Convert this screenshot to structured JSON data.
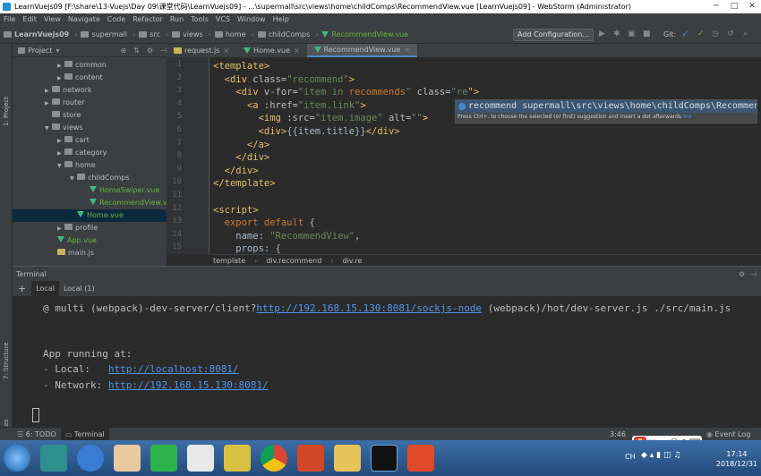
{
  "window": {
    "title": "LearnVuejs09 [F:\\share\\13-Vuejs\\Day 09\\课堂代码\\LearnVuejs09] - ...\\supermall\\src\\views\\home\\childComps\\RecommendView.vue [LearnVuejs09] - WebStorm (Administrator)",
    "min": "─",
    "max": "□",
    "close": "✕"
  },
  "menu": [
    "File",
    "Edit",
    "View",
    "Navigate",
    "Code",
    "Refactor",
    "Run",
    "Tools",
    "VCS",
    "Window",
    "Help"
  ],
  "nav": {
    "crumbs": [
      "LearnVuejs09",
      "supermall",
      "src",
      "views",
      "home",
      "childComps",
      "RecommendView.vue"
    ],
    "add_config": "Add Configuration...",
    "git": "Git:"
  },
  "left_strip": {
    "project": "1: Project",
    "structure": "7: Structure",
    "favorites": "2: Favorites"
  },
  "project": {
    "label": "Project",
    "tree": [
      {
        "name": "common",
        "indent": 1,
        "type": "folder"
      },
      {
        "name": "content",
        "indent": 1,
        "type": "folder"
      },
      {
        "name": "network",
        "indent": 0,
        "type": "folder"
      },
      {
        "name": "router",
        "indent": 0,
        "type": "folder"
      },
      {
        "name": "store",
        "indent": 0,
        "type": "folder"
      },
      {
        "name": "views",
        "indent": 0,
        "type": "folder"
      },
      {
        "name": "cart",
        "indent": 1,
        "type": "folder"
      },
      {
        "name": "category",
        "indent": 1,
        "type": "folder"
      },
      {
        "name": "home",
        "indent": 1,
        "type": "folder"
      },
      {
        "name": "childComps",
        "indent": 2,
        "type": "folder"
      },
      {
        "name": "HomeSwiper.vue",
        "indent": 3,
        "type": "vue"
      },
      {
        "name": "RecommendView.vue",
        "indent": 3,
        "type": "vue"
      },
      {
        "name": "Home.vue",
        "indent": 2,
        "type": "vue"
      },
      {
        "name": "profile",
        "indent": 1,
        "type": "folder"
      },
      {
        "name": "App.vue",
        "indent": 0,
        "type": "vue"
      },
      {
        "name": "main.js",
        "indent": 0,
        "type": "js"
      }
    ]
  },
  "tabs": [
    "request.js",
    "Home.vue",
    "RecommendView.vue"
  ],
  "editor": {
    "line_numbers": [
      "1",
      "2",
      "3",
      "4",
      "5",
      "6",
      "7",
      "8",
      "9",
      "10",
      "11",
      "12",
      "13",
      "14",
      "15"
    ],
    "lines": [
      [
        [
          "tag",
          "<template>"
        ]
      ],
      [
        [
          "tag",
          "  <div "
        ],
        [
          "attr",
          "class="
        ],
        [
          "str",
          "\"recommend\""
        ],
        [
          "tag",
          ">"
        ]
      ],
      [
        [
          "tag",
          "    <div "
        ],
        [
          "attr",
          "v-for="
        ],
        [
          "str",
          "\"item in "
        ],
        [
          "kw",
          "recommends"
        ],
        [
          "str",
          "\" "
        ],
        [
          "attr",
          "class="
        ],
        [
          "str",
          "\"re"
        ],
        [
          "tag",
          "\">"
        ]
      ],
      [
        [
          "tag",
          "      <a "
        ],
        [
          "attr",
          ":href="
        ],
        [
          "str",
          "\"item.link\""
        ],
        [
          "tag",
          ">"
        ]
      ],
      [
        [
          "tag",
          "        <img "
        ],
        [
          "attr",
          ":src="
        ],
        [
          "str",
          "\"item.image\" "
        ],
        [
          "attr",
          "alt="
        ],
        [
          "str",
          "\"\""
        ],
        [
          "tag",
          ">"
        ]
      ],
      [
        [
          "tag",
          "        <div>"
        ],
        [
          "plain",
          "{{item.title}}"
        ],
        [
          "tag",
          "</div>"
        ]
      ],
      [
        [
          "tag",
          "      </a>"
        ]
      ],
      [
        [
          "tag",
          "    </div>"
        ]
      ],
      [
        [
          "tag",
          "  </div>"
        ]
      ],
      [
        [
          "tag",
          "</template>"
        ]
      ],
      [
        [
          "plain",
          ""
        ]
      ],
      [
        [
          "tag",
          "<script>"
        ]
      ],
      [
        [
          "kw",
          "  export default "
        ],
        [
          "plain",
          "{"
        ]
      ],
      [
        [
          "plain",
          "    name: "
        ],
        [
          "str",
          "\"RecommendView\""
        ],
        [
          "plain",
          ","
        ]
      ],
      [
        [
          "plain",
          "    props: {"
        ]
      ]
    ],
    "breadcrumbs": [
      "template",
      "div.recommend",
      "div.re"
    ]
  },
  "popup": {
    "suggestion": "recommend  supermall\\src\\views\\home\\childComps\\RecommendView.vue",
    "hint": "Press Ctrl+. to choose the selected (or first) suggestion and insert a dot afterwards",
    "more": ">>"
  },
  "terminal": {
    "header": "Terminal",
    "tabs": [
      "Local",
      "Local (1)"
    ],
    "line1_pre": "@ multi (webpack)-dev-server/client?",
    "line1_link": "http://192.168.15.130:8081/sockjs-node",
    "line1_post": " (webpack)/hot/dev-server.js ./src/main.js",
    "running": "App running at:",
    "local_label": "- Local:   ",
    "local_url": "http://localhost:8081/",
    "network_label": "- Network: ",
    "network_url": "http://192.168.15.130:8081/"
  },
  "bottom": {
    "todo": "6: TODO",
    "terminal": "Terminal",
    "position": "3:46",
    "event_log": "Event Log"
  },
  "ime": {
    "lang": "英"
  },
  "clock": {
    "time": "17:14",
    "date": "2018/12/31",
    "ch": "CH"
  }
}
